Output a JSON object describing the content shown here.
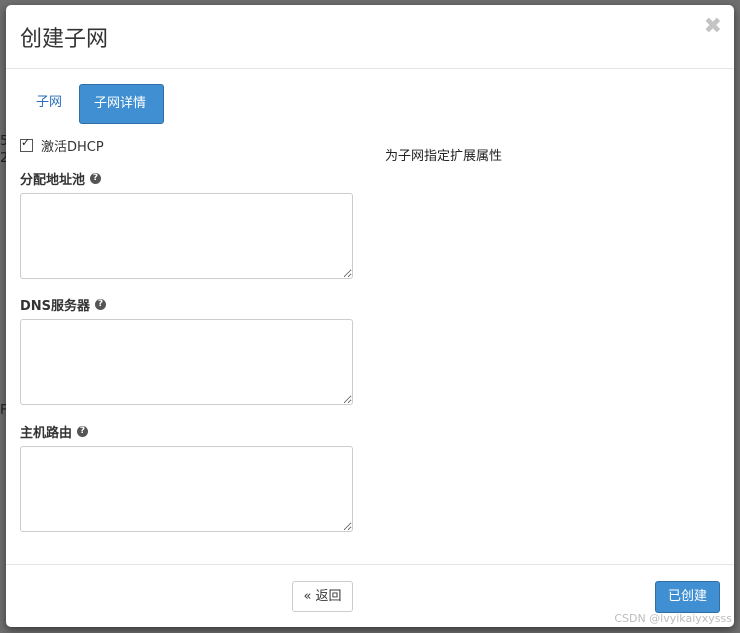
{
  "backdrop": {
    "fragments": [
      "5",
      "2",
      "F"
    ]
  },
  "dialog": {
    "title": "创建子网",
    "close_symbol": "✖"
  },
  "tabs": [
    {
      "label": "子网",
      "active": false
    },
    {
      "label": "子网详情",
      "active": true
    }
  ],
  "form": {
    "dhcp": {
      "label": "激活DHCP",
      "checked": true
    },
    "allocation_pools": {
      "label": "分配地址池",
      "help_symbol": "?",
      "value": ""
    },
    "dns_servers": {
      "label": "DNS服务器",
      "help_symbol": "?",
      "value": ""
    },
    "host_routes": {
      "label": "主机路由",
      "help_symbol": "?",
      "value": ""
    }
  },
  "side_note": "为子网指定扩展属性",
  "footer": {
    "back_label": "« 返回",
    "create_label": "已创建"
  },
  "watermark": "CSDN @lvyikaiyxysss",
  "colors": {
    "primary": "#3f8fd2",
    "link": "#2a6ebb",
    "overlay": "#6f6f6f"
  }
}
